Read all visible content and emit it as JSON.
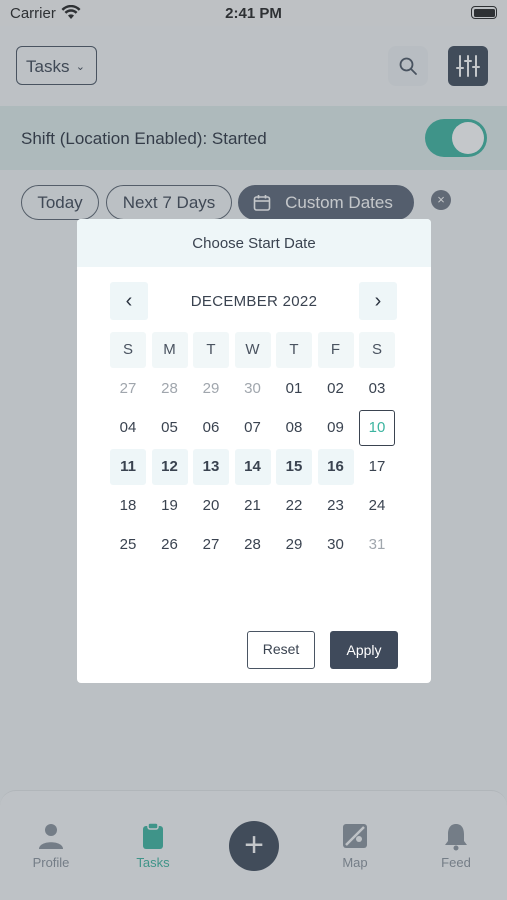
{
  "status_bar": {
    "carrier": "Carrier",
    "time": "2:41 PM"
  },
  "header": {
    "dropdown_label": "Tasks",
    "chevron": "⌄"
  },
  "shift": {
    "label": "Shift (Location Enabled): Started",
    "toggle_on": true
  },
  "filters": {
    "today": "Today",
    "next7": "Next 7 Days",
    "custom": "Custom Dates",
    "clear_glyph": "×"
  },
  "tabbar": {
    "profile": "Profile",
    "tasks": "Tasks",
    "add": "+",
    "map": "Map",
    "feed": "Feed"
  },
  "modal": {
    "title": "Choose Start Date",
    "month": "DECEMBER 2022",
    "prev": "‹",
    "next": "›",
    "weekdays": [
      "S",
      "M",
      "T",
      "W",
      "T",
      "F",
      "S"
    ],
    "days": [
      [
        "27",
        "28",
        "29",
        "30",
        "01",
        "02",
        "03"
      ],
      [
        "04",
        "05",
        "06",
        "07",
        "08",
        "09",
        "10"
      ],
      [
        "11",
        "12",
        "13",
        "14",
        "15",
        "16",
        "17"
      ],
      [
        "18",
        "19",
        "20",
        "21",
        "22",
        "23",
        "24"
      ],
      [
        "25",
        "26",
        "27",
        "28",
        "29",
        "30",
        "31"
      ]
    ],
    "dimmed": [
      "0-0",
      "0-1",
      "0-2",
      "0-3",
      "4-6"
    ],
    "selected": "1-6",
    "highlighted": [
      "2-0",
      "2-1",
      "2-2",
      "2-3",
      "2-4",
      "2-5"
    ],
    "reset": "Reset",
    "apply": "Apply"
  },
  "colors": {
    "accent": "#3cb4a0",
    "dark": "#3f4a5b"
  },
  "icons": [
    "wifi-icon",
    "battery-icon",
    "search-icon",
    "filter-sliders-icon",
    "calendar-icon",
    "clear-icon",
    "profile-icon",
    "tasks-clipboard-icon",
    "add-icon",
    "map-icon",
    "feed-bell-icon",
    "chevron-left-icon",
    "chevron-right-icon"
  ]
}
